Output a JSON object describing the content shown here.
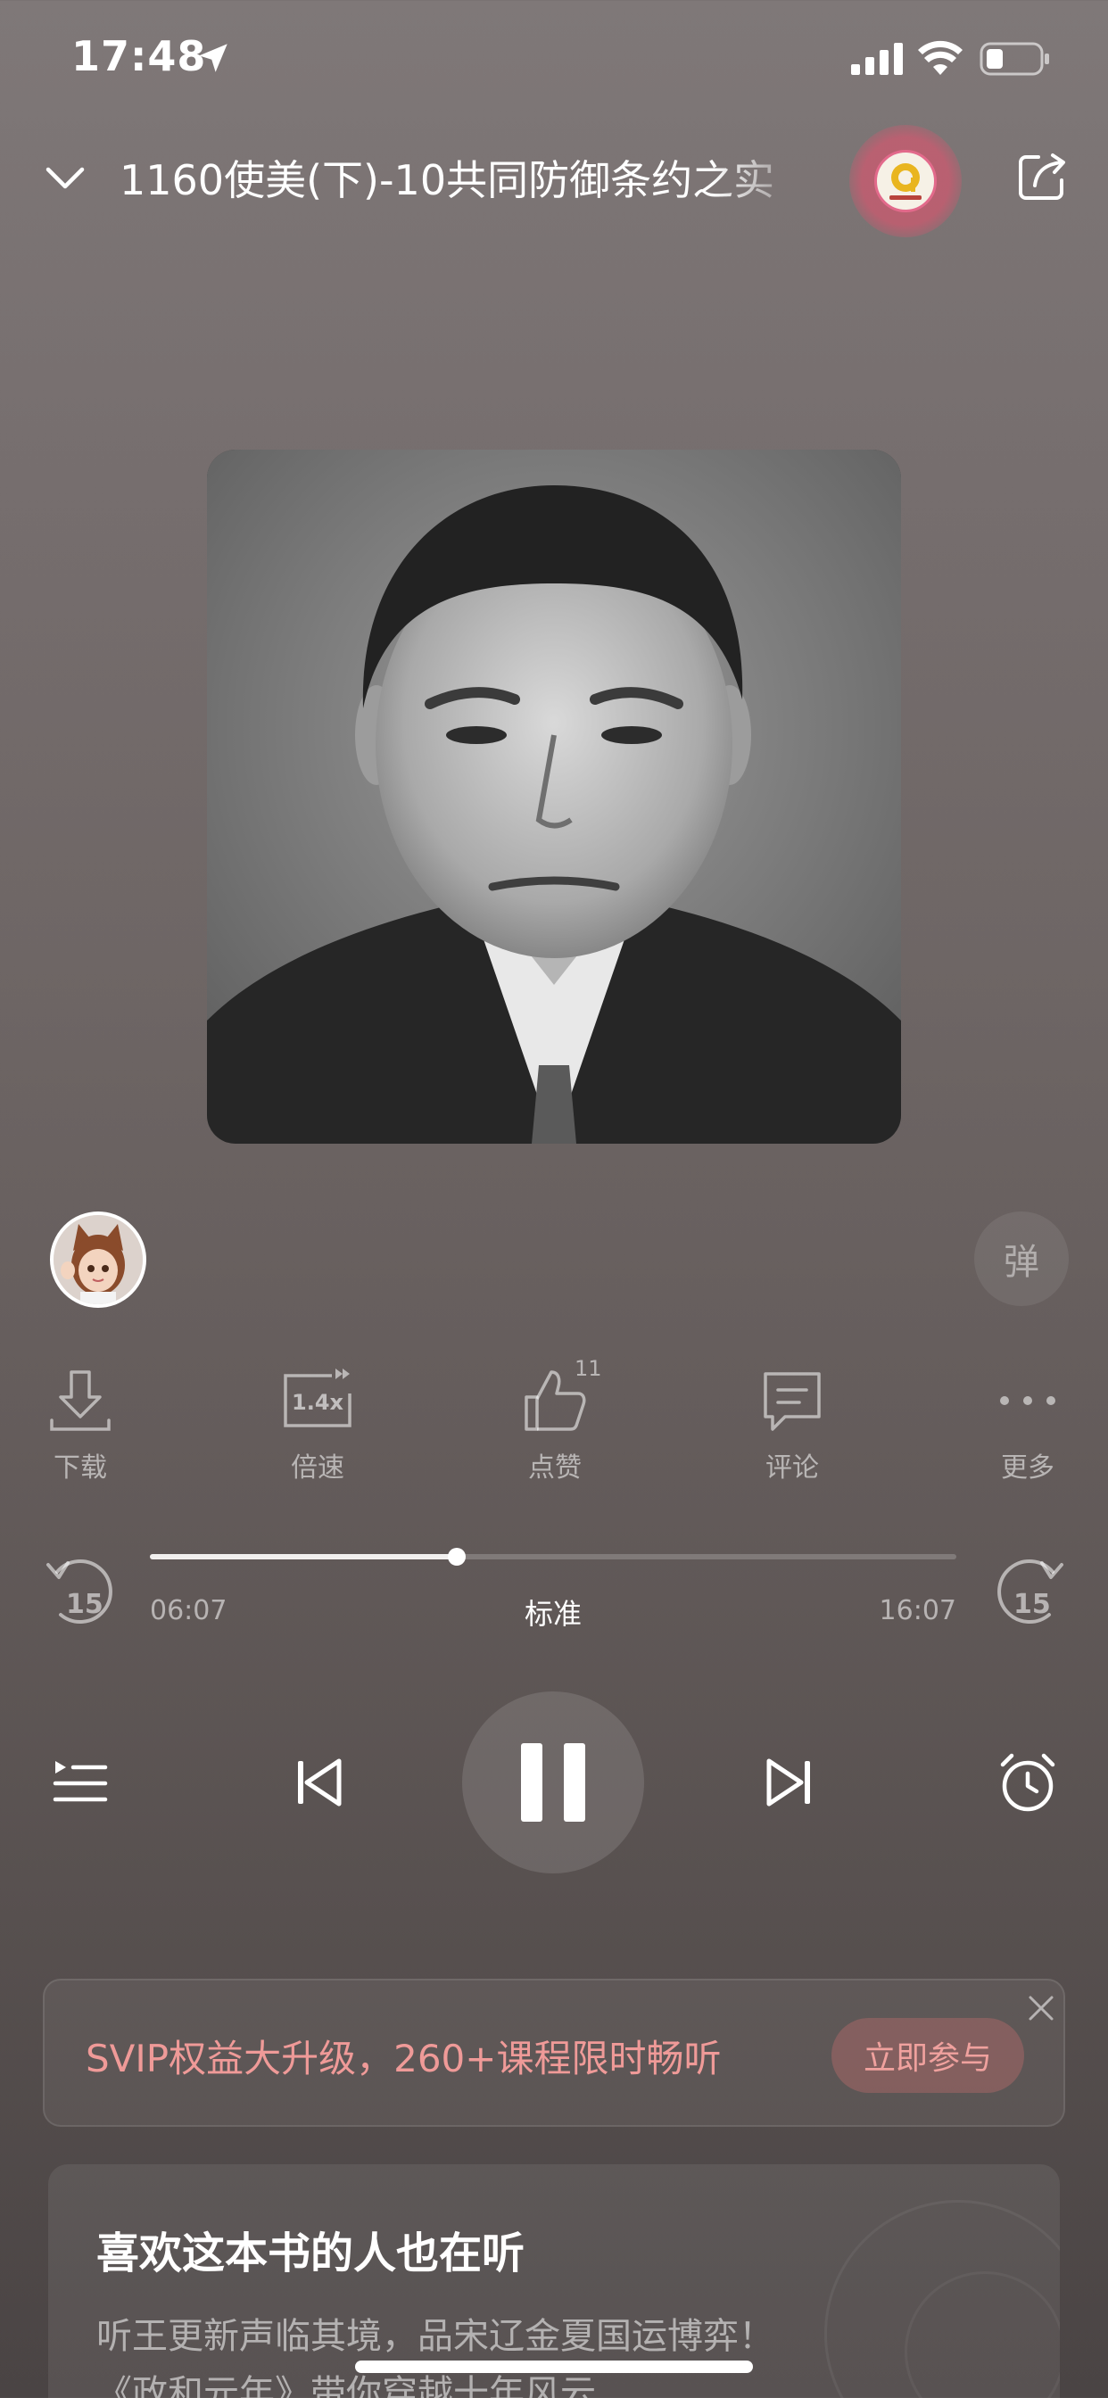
{
  "status_bar": {
    "time": "17:48",
    "icons": [
      "location-arrow-icon",
      "cellular-signal-icon",
      "wifi-icon",
      "battery-icon"
    ]
  },
  "header": {
    "title": "1160使美(下)-10共同防御条约之实",
    "icons": [
      "chevron-down-icon",
      "share-icon"
    ]
  },
  "actions": [
    {
      "label": "下载",
      "icon": "download-icon"
    },
    {
      "label": "倍速",
      "icon": "speed-icon",
      "speed": "1.4x"
    },
    {
      "label": "点赞",
      "icon": "thumbs-up-icon",
      "count": "11"
    },
    {
      "label": "评论",
      "icon": "comment-icon"
    },
    {
      "label": "更多",
      "icon": "more-icon"
    }
  ],
  "danmaku_label": "弹",
  "player": {
    "current_time": "06:07",
    "total_time": "16:07",
    "quality": "标准",
    "progress": 0.38,
    "skip_back": "15",
    "skip_forward": "15"
  },
  "promo": {
    "text": "SVIP权益大升级，260+课程限时畅听",
    "button": "立即参与"
  },
  "recommend": {
    "title": "喜欢这本书的人也在听",
    "line1": "听王更新声临其境，品宋辽金夏国运博弈！",
    "line2": "《政和元年》带你穿越十年风云"
  },
  "colors": {
    "accent_pink": "#ef9a98",
    "badge_ring": "#e26a8b"
  }
}
